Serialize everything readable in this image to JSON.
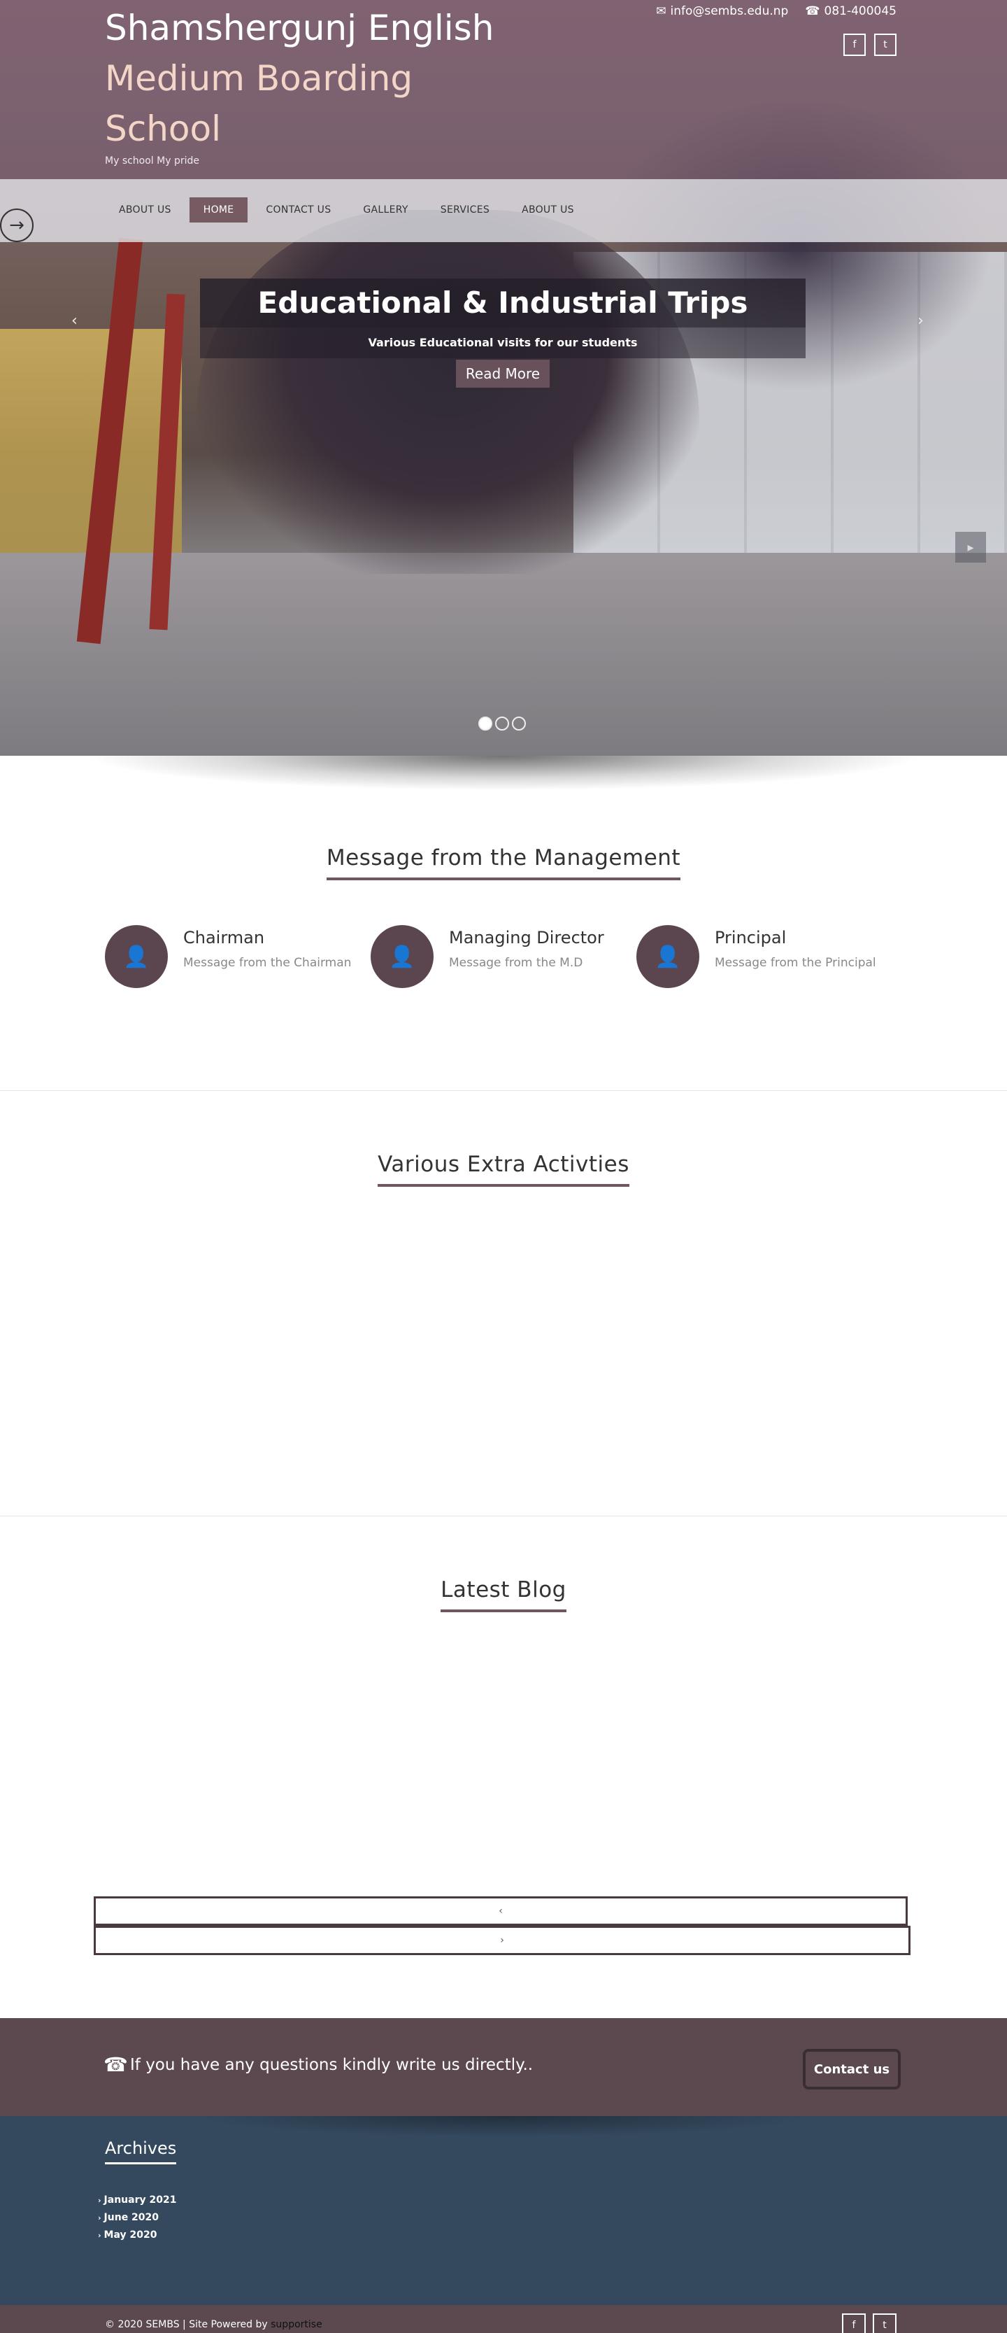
{
  "header": {
    "brand_lines": [
      "Shamshergunj English",
      "Medium Boarding",
      "School"
    ],
    "tagline": "My school My pride",
    "email": "info@sembs.edu.np",
    "phone": "081-400045",
    "icons": {
      "email": "envelope-icon",
      "phone": "phone-icon",
      "social1": "facebook-icon",
      "social2": "twitter-icon"
    }
  },
  "nav": {
    "items": [
      {
        "label": "ABOUT US",
        "active": false
      },
      {
        "label": "HOME",
        "active": true
      },
      {
        "label": "CONTACT US",
        "active": false
      },
      {
        "label": "GALLERY",
        "active": false
      },
      {
        "label": "SERVICES",
        "active": false
      },
      {
        "label": "ABOUT US",
        "active": false
      }
    ]
  },
  "slider": {
    "title": "Educational & Industrial Trips",
    "subtitle": "Various Educational visits for our students",
    "read_more": "Read More",
    "dots": 3,
    "active_dot": 1
  },
  "management": {
    "title": "Message from the Management",
    "items": [
      {
        "name": "Chairman",
        "desc": "Message from the Chairman",
        "icon": "user-icon"
      },
      {
        "name": "Managing Director",
        "desc": "Message from the M.D",
        "icon": "user-icon"
      },
      {
        "name": "Principal",
        "desc": "Message from the Principal",
        "icon": "user-icon"
      }
    ]
  },
  "activities": {
    "title": "Various Extra Activties"
  },
  "blog": {
    "title": "Latest Blog"
  },
  "cta": {
    "text": "If you have any questions kindly write us directly..",
    "button": "Contact us",
    "icon": "phone-icon"
  },
  "footer": {
    "archives_title": "Archives",
    "archives": [
      "January 2021",
      "June 2020",
      "May 2020"
    ],
    "copyright": "© 2020 SEMBS | Site Powered by",
    "powered_by": "supportise"
  },
  "colors": {
    "accent": "#5c4950",
    "nav_active": "#765c62",
    "footer_bg": "#34495e"
  }
}
